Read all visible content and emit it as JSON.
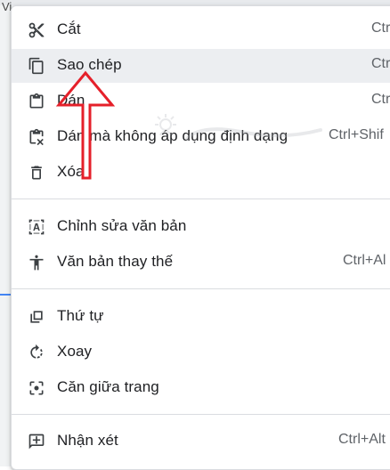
{
  "background": {
    "leftchar": "Vi"
  },
  "menu": {
    "items": [
      {
        "name": "cut",
        "label": "Cắt",
        "shortcut": "Ctr",
        "icon": "scissors-icon"
      },
      {
        "name": "copy",
        "label": "Sao chép",
        "shortcut": "Ctr",
        "icon": "copy-icon",
        "highlighted": true
      },
      {
        "name": "paste",
        "label": "Dán",
        "shortcut": "Ctr",
        "icon": "clipboard-icon"
      },
      {
        "name": "paste-unformatted",
        "label": "Dán mà không áp dụng định dạng",
        "shortcut": "Ctrl+Shif",
        "icon": "clipboard-clear-icon"
      },
      {
        "name": "delete",
        "label": "Xóa",
        "shortcut": "",
        "icon": "trash-icon"
      },
      {
        "name": "edit-text",
        "label": "Chỉnh sửa văn bản",
        "shortcut": "",
        "icon": "text-box-icon"
      },
      {
        "name": "alt-text",
        "label": "Văn bản thay thế",
        "shortcut": "Ctrl+Al",
        "icon": "accessibility-icon"
      },
      {
        "name": "order",
        "label": "Thứ tự",
        "shortcut": "",
        "icon": "layers-icon"
      },
      {
        "name": "rotate",
        "label": "Xoay",
        "shortcut": "",
        "icon": "rotate-icon"
      },
      {
        "name": "center",
        "label": "Căn giữa trang",
        "shortcut": "",
        "icon": "center-focus-icon"
      },
      {
        "name": "comment",
        "label": "Nhận xét",
        "shortcut": "Ctrl+Alt",
        "icon": "add-comment-icon"
      }
    ]
  },
  "colors": {
    "highlight": "#eceef1",
    "arrow": "#e5202a",
    "text": "#202124",
    "shortcut": "#5f6368"
  }
}
